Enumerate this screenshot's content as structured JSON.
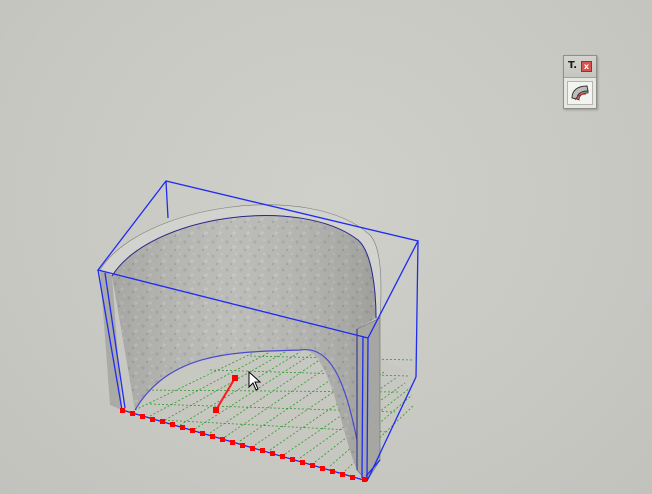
{
  "toolbar": {
    "title": "T.",
    "close_label": "x",
    "tool_icon": "curved-wall-tool-icon"
  },
  "colors": {
    "viewport_background": "#c9c9c4",
    "selection_bbox": "#1f2cf0",
    "wall_surface": "#b5b5b2",
    "grid_lines": "#2f9a2f",
    "endpoint_markers": "#ff0000"
  },
  "cursor_icon": "arrow-cursor-icon"
}
